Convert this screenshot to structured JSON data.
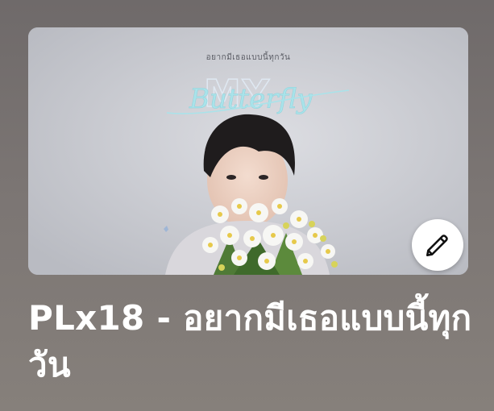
{
  "cover": {
    "thai_caption": "อยากมีเธอแบบนี้ทุกวัน",
    "big_letters": "MY",
    "script_text": "Butterfly"
  },
  "title": "PLx18 - อยากมีเธอแบบนี้ทุกวัน",
  "edit_button_icon": "pencil-icon"
}
